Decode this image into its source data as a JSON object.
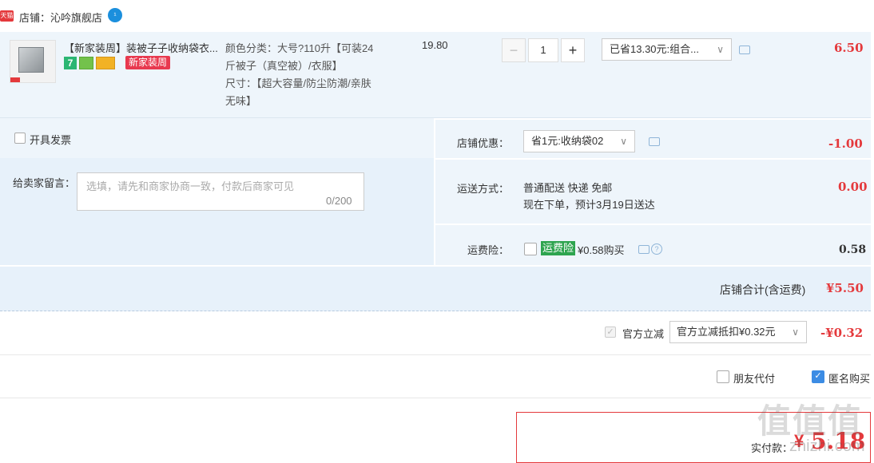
{
  "store": {
    "badge": "天猫",
    "name": "店铺：沁吟旗舰店",
    "ww_icon": "¹"
  },
  "item": {
    "title": "【新家装周】装被子子收纳袋衣...",
    "service_icons": [
      "7",
      "green-badge-icon",
      "card-icon"
    ],
    "promo_badge": "新家装周",
    "sku_lines": [
      "颜色分类：大号?110升【可装24",
      "斤被子（真空被）/衣服】",
      "尺寸：【超大容量/防尘防潮/亲肤",
      "无味】"
    ],
    "unit_price": "19.80",
    "quantity": "1",
    "qty_minus": "−",
    "qty_plus": "+",
    "discount_label": "已省13.30元:组合...",
    "subtotal": "6.50"
  },
  "invoice": {
    "label": "开具发票"
  },
  "message": {
    "label": "给卖家留言：",
    "placeholder": "选填，请先和商家协商一致，付款后商家可见",
    "counter": "0/200"
  },
  "store_coupon": {
    "label": "店铺优惠：",
    "value": "省1元:收纳袋02",
    "amount": "-1.00"
  },
  "shipping": {
    "label": "运送方式：",
    "method": "普通配送 快递 免邮",
    "eta": "现在下单，预计3月19日送达",
    "amount": "0.00"
  },
  "insurance": {
    "label": "运费险：",
    "badge": "运费险",
    "price_text": "¥0.58购买",
    "amount": "0.58"
  },
  "store_total": {
    "label": "店铺合计(含运费)",
    "amount": "¥5.50"
  },
  "official_discount": {
    "label": "官方立减",
    "select_value": "官方立减抵扣¥0.32元",
    "amount": "-¥0.32"
  },
  "options": {
    "friend_pay": "朋友代付",
    "anonymous": "匿名购买"
  },
  "payment": {
    "label": "实付款：",
    "currency": "¥",
    "amount": "5.18"
  },
  "watermark": {
    "text": "值值值",
    "url": "zhizhi.com"
  },
  "icons": {
    "chevron": "∨",
    "check": "✓"
  },
  "colors": {
    "price_red": "#e4393c",
    "row_blue": "#eef5fb",
    "accent_blue": "#3c8ce4",
    "insurance_green": "#2ea44f"
  }
}
